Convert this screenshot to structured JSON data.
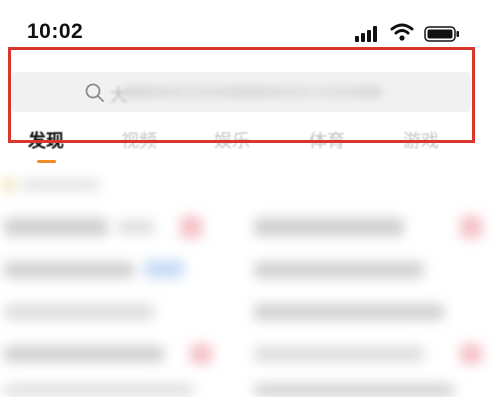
{
  "status_bar": {
    "time": "10:02",
    "icons": [
      "cellular-signal-icon",
      "wifi-icon",
      "battery-icon"
    ]
  },
  "search": {
    "icon": "search-icon",
    "placeholder_first_char": "大"
  },
  "tabs": [
    {
      "label": "发现",
      "active": true
    },
    {
      "label": "视频",
      "active": false
    },
    {
      "label": "娱乐",
      "active": false
    },
    {
      "label": "体育",
      "active": false
    },
    {
      "label": "游戏",
      "active": false
    }
  ],
  "colors": {
    "highlight_border": "#d9372e",
    "active_tab_indicator": "#f28c28",
    "search_background": "#f1f1f2"
  }
}
